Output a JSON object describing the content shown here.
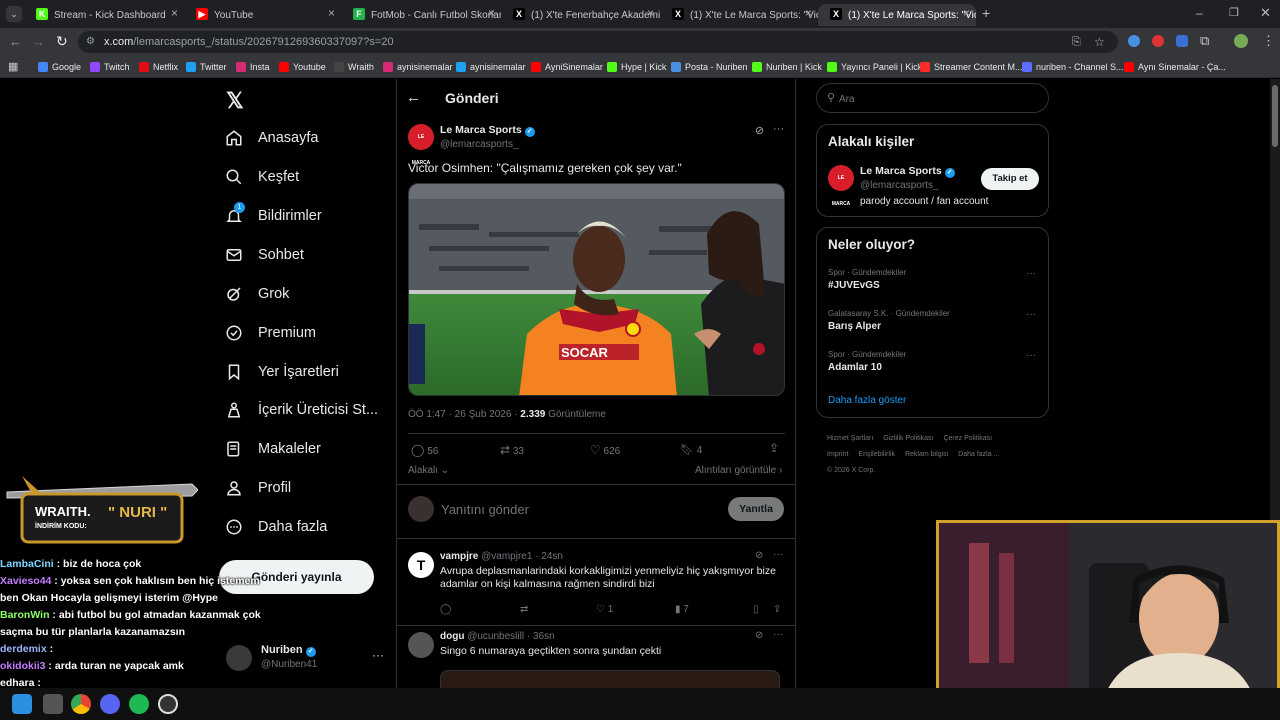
{
  "tabs": [
    {
      "label": "Stream - Kick Dashboard",
      "fav": "K",
      "color": "#53fc18"
    },
    {
      "label": "YouTube",
      "fav": "▶",
      "color": "#ff0000"
    },
    {
      "label": "FotMob - Canlı Futbol Skorları",
      "fav": "F",
      "color": "#22b14c"
    },
    {
      "label": "(1) X'te Fenerbahçe Akademi B...",
      "fav": "X",
      "color": "#000000"
    },
    {
      "label": "(1) X'te Le Marca Sports: \"Victo...",
      "fav": "X",
      "color": "#000000"
    },
    {
      "label": "(1) X'te Le Marca Sports: \"Victo...",
      "fav": "X",
      "color": "#000000"
    }
  ],
  "url": {
    "host": "x.com",
    "path": "/lemarcasports_/status/2026791269360337097?s=20"
  },
  "bookmarks": [
    "Google",
    "Twitch",
    "Netflix",
    "Twitter",
    "Insta",
    "Youtube",
    "Wraith",
    "aynisinemalar",
    "aynisinemalar",
    "AyniSinemalar",
    "Hype | Kick",
    "Posta - Nuriben",
    "Nuriben | Kick",
    "Yayıncı Paneli | Kick",
    "Streamer Content M...",
    "nuriben - Channel S...",
    "Aynı Sinemalar - Ça..."
  ],
  "nav": {
    "home": "Anasayfa",
    "explore": "Keşfet",
    "notifications": "Bildirimler",
    "notif_badge": "1",
    "chat": "Sohbet",
    "grok": "Grok",
    "premium": "Premium",
    "bookmarks": "Yer İşaretleri",
    "creator": "İçerik Üreticisi St...",
    "articles": "Makaleler",
    "profile": "Profil",
    "more": "Daha fazla",
    "post_button": "Gönderi yayınla",
    "account_name": "Nuriben",
    "account_handle": "@Nuriben41"
  },
  "post": {
    "header": "Gönderi",
    "author_name": "Le Marca Sports",
    "author_handle": "@lemarcasports_",
    "avatar_text": "LE MARCA",
    "text": "Victor Osimhen: \"Çalışmamız gereken çok şey var.\"",
    "time": "ÖÖ 1:47 · 26 Şub 2026 · ",
    "views_count": "2.339",
    "views_label": " Görüntüleme",
    "replies": "56",
    "reposts": "33",
    "likes": "626",
    "bookmarks": "4",
    "relevance": "Alakalı",
    "quotes_link": "Alıntıları görüntüle",
    "reply_placeholder": "Yanıtını gönder",
    "reply_button": "Yanıtla"
  },
  "replies": [
    {
      "name": "vampjre",
      "handle": "@vampjre1 · 24sn",
      "avatar": "T",
      "text": "Avrupa deplasmanlarindaki korkakligimizi yenmeliyiz hiç yakışmıyor bize adamlar on kişi kalmasına rağmen sindirdi bizi",
      "likes": "1",
      "views": "7"
    },
    {
      "name": "dogu",
      "handle": "@ucunbeslill · 36sn",
      "avatar": "",
      "text": "Singo 6 numaraya geçtikten sonra şundan çekti",
      "likes": "",
      "views": ""
    }
  ],
  "sidebar": {
    "search_placeholder": "Ara",
    "related_title": "Alakalı kişiler",
    "related": {
      "name": "Le Marca Sports",
      "handle": "@lemarcasports_",
      "bio": "parody account / fan account",
      "follow": "Takip et"
    },
    "trends_title": "Neler oluyor?",
    "trends": [
      {
        "context": "Spor · Gündemdekiler",
        "topic": "#JUVEvGS"
      },
      {
        "context": "Galatasaray S.K. · Gündemdekiler",
        "topic": "Barış Alper"
      },
      {
        "context": "Spor · Gündemdekiler",
        "topic": "Adamlar 10"
      }
    ],
    "show_more": "Daha fazla göster",
    "footer": [
      "Hizmet Şartları",
      "Gizlilik Politikası",
      "Çerez Politikası",
      "Imprint",
      "Erişilebilirlik",
      "Reklam bilgisi",
      "Daha fazla ...",
      "© 2026 X Corp."
    ]
  },
  "overlay": {
    "sponsor_title": "WRAITH.",
    "sponsor_code_label": "İNDİRİM KODU:",
    "sponsor_code": "\" NURI \"",
    "chat": [
      {
        "user": "LambaCini",
        "color": "#7fd6ff",
        "msg": "biz de hoca çok"
      },
      {
        "user": "Xavieso44",
        "color": "#c47dff",
        "msg": "yoksa sen çok haklısın ben hiç istemem ben Okan Hocayla gelişmeyi isterim @Hype"
      },
      {
        "user": "BaronWin",
        "color": "#8cff6b",
        "msg": "abi futbol bu gol atmadan kazanmak çok saçma bu tür planlarla kazanamazsın"
      },
      {
        "user": "derdemix",
        "color": "#9fb4ff",
        "msg": ""
      },
      {
        "user": "okidokii3",
        "color": "#c47dff",
        "msg": "arda turan ne yapcak amk"
      },
      {
        "user": "edhara",
        "color": "#ffffff",
        "msg": ""
      }
    ]
  }
}
